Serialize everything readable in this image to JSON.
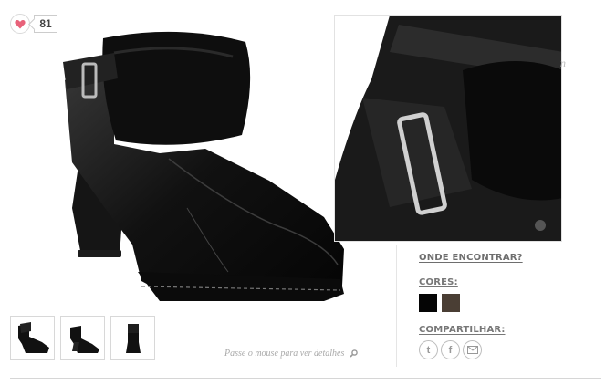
{
  "like": {
    "icon": "heart-icon",
    "count": "81"
  },
  "main_image": {
    "subject": "black leather ankle boot with shearling cuff and buckle strap"
  },
  "zoom": {
    "edge_char": "n"
  },
  "thumbnails": [
    {
      "icon": "boot-side-thumb"
    },
    {
      "icon": "boot-side-unfolded-thumb"
    },
    {
      "icon": "boot-front-thumb"
    }
  ],
  "hint": {
    "text": "Passe o mouse para ver detalhes",
    "icon": "search-icon"
  },
  "where": {
    "label": "ONDE ENCONTRAR?"
  },
  "colors": {
    "label": "CORES:",
    "swatches": [
      {
        "name": "black",
        "color": "#050505"
      },
      {
        "name": "brown",
        "color": "#4a3e34"
      }
    ]
  },
  "share": {
    "label": "COMPARTILHAR:",
    "buttons": [
      {
        "icon": "twitter-icon",
        "glyph": "t"
      },
      {
        "icon": "facebook-icon",
        "glyph": "f"
      },
      {
        "icon": "email-icon",
        "glyph": ""
      }
    ]
  }
}
